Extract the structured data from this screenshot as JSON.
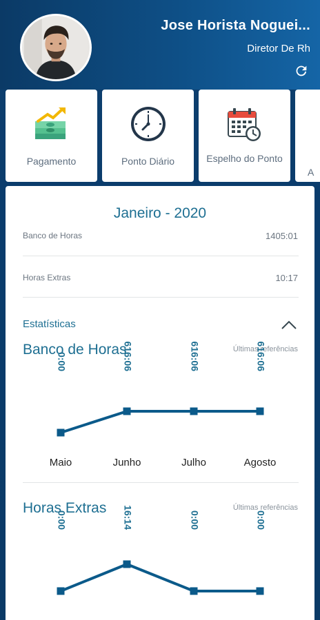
{
  "user": {
    "name": "Jose Horista Noguei...",
    "role": "Diretor De Rh"
  },
  "tiles": [
    {
      "label": "Pagamento",
      "icon": "money-growth-icon"
    },
    {
      "label": "Ponto Diário",
      "icon": "clock-icon"
    },
    {
      "label": "Espelho do Ponto",
      "icon": "calendar-clock-icon"
    },
    {
      "label": "A",
      "icon": "partial-tile-icon"
    }
  ],
  "summary": {
    "month": "Janeiro - 2020",
    "bank_label": "Banco de Horas",
    "bank_value": "1405:01",
    "extra_label": "Horas Extras",
    "extra_value": "10:17"
  },
  "stats": {
    "title": "Estatísticas"
  },
  "charts": {
    "bank": {
      "title": "Banco de Horas",
      "subtitle": "Últimas referências"
    },
    "extra": {
      "title": "Horas Extras",
      "subtitle": "Últimas referências"
    }
  },
  "colors": {
    "accent": "#1e6f92",
    "line": "#0b5a8a",
    "header_dark": "#0b3a66"
  },
  "chart_data": [
    {
      "type": "line",
      "title": "Banco de Horas",
      "categories": [
        "Maio",
        "Junho",
        "Julho",
        "Agosto"
      ],
      "values": [
        0,
        616.1,
        616.1,
        616.1
      ],
      "labels": [
        "0:00",
        "616:06",
        "616:06",
        "616:06"
      ]
    },
    {
      "type": "line",
      "title": "Horas Extras",
      "categories": [],
      "values": [
        0,
        16.23,
        0,
        0
      ],
      "labels": [
        "0:00",
        "16:14",
        "0:00",
        "0:00"
      ]
    }
  ]
}
